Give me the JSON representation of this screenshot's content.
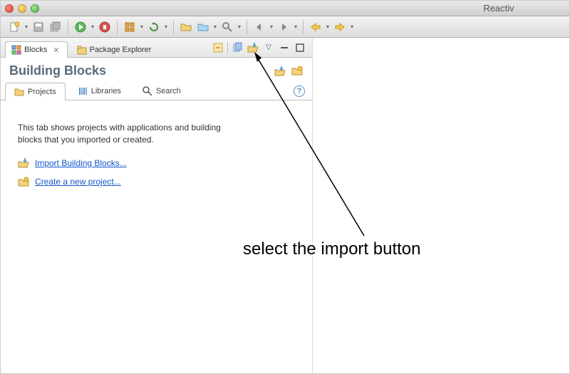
{
  "window": {
    "title": "Reactiv"
  },
  "view_tabs": {
    "active": "Blocks",
    "items": [
      {
        "label": "Blocks",
        "closeable": true
      },
      {
        "label": "Package Explorer",
        "closeable": false
      }
    ]
  },
  "panel": {
    "title": "Building Blocks"
  },
  "inner_tabs": {
    "active": "Projects",
    "items": [
      {
        "label": "Projects"
      },
      {
        "label": "Libraries"
      },
      {
        "label": "Search"
      }
    ]
  },
  "projects_tab": {
    "intro": "This tab shows projects with applications and building blocks that you imported or created.",
    "import_link": "Import Building Blocks...",
    "create_link": "Create a new project..."
  },
  "annotation": {
    "text": "select the import button"
  }
}
